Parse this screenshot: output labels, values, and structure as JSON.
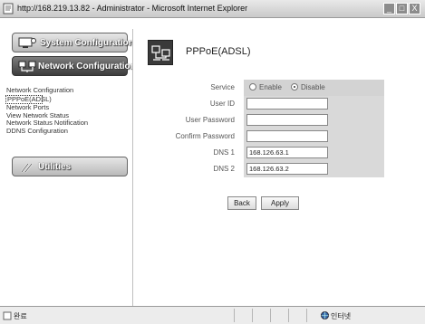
{
  "window": {
    "title": "http://168.219.13.82 - Administrator - Microsoft Internet Explorer",
    "controls": {
      "minimize": "_",
      "maximize": "□",
      "close": "X"
    }
  },
  "sidebar": {
    "system_configuration": "System Configuration",
    "network_configuration": "Network Configuration",
    "utilities": "Utilities",
    "links": [
      {
        "label": "Network Configuration",
        "active": false
      },
      {
        "label": "PPPoE(ADSL)",
        "active": true
      },
      {
        "label": "Network Ports",
        "active": false
      },
      {
        "label": "View Network Status",
        "active": false
      },
      {
        "label": "Network Status Notification",
        "active": false
      },
      {
        "label": "DDNS Configuration",
        "active": false
      }
    ]
  },
  "page": {
    "title": "PPPoE(ADSL)"
  },
  "form": {
    "service_label": "Service",
    "service_enable": "Enable",
    "service_disable": "Disable",
    "service_selected": "Disable",
    "user_id_label": "User ID",
    "user_id_value": "",
    "user_password_label": "User Password",
    "user_password_value": "",
    "confirm_password_label": "Confirm Password",
    "confirm_password_value": "",
    "dns1_label": "DNS 1",
    "dns1_value": "168.126.63.1",
    "dns2_label": "DNS 2",
    "dns2_value": "168.126.63.2"
  },
  "buttons": {
    "back": "Back",
    "apply": "Apply"
  },
  "statusbar": {
    "status": "완료",
    "zone": "인터넷"
  },
  "icons": {
    "browser": "ie-page-icon",
    "system": "monitor-icon",
    "network": "network-icon",
    "utilities": "tools-icon",
    "page": "network-computers-icon",
    "zone": "globe-icon"
  }
}
